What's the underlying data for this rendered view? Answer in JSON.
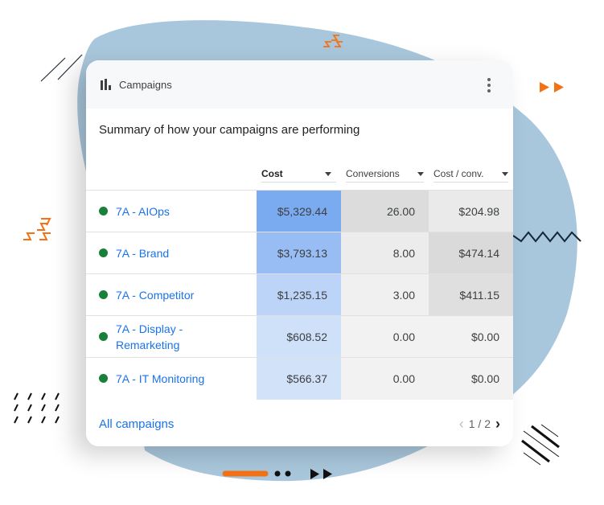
{
  "widget": {
    "title": "Campaigns",
    "subtitle": "Summary of how your campaigns are performing",
    "icon": "bar-chart-icon",
    "menu_icon": "more-vert-icon"
  },
  "table": {
    "columns": [
      {
        "label": "Cost",
        "sorted": true
      },
      {
        "label": "Conversions",
        "sorted": false
      },
      {
        "label": "Cost / conv.",
        "sorted": false
      }
    ],
    "rows": [
      {
        "name": "7A - AIOps",
        "status": "enabled",
        "cost": "$5,329.44",
        "conversions": "26.00",
        "cost_per_conv": "$204.98"
      },
      {
        "name": "7A - Brand",
        "status": "enabled",
        "cost": "$3,793.13",
        "conversions": "8.00",
        "cost_per_conv": "$474.14"
      },
      {
        "name": "7A - Competitor",
        "status": "enabled",
        "cost": "$1,235.15",
        "conversions": "3.00",
        "cost_per_conv": "$411.15"
      },
      {
        "name": "7A - Display - Remarketing",
        "status": "enabled",
        "cost": "$608.52",
        "conversions": "0.00",
        "cost_per_conv": "$0.00"
      },
      {
        "name": "7A - IT Monitoring",
        "status": "enabled",
        "cost": "$566.37",
        "conversions": "0.00",
        "cost_per_conv": "$0.00"
      }
    ]
  },
  "footer": {
    "link": "All campaigns",
    "page": "1 / 2"
  },
  "colors": {
    "link": "#1a73e8",
    "status_dot": "#188038",
    "blob": "#a9c7dc",
    "accent_orange": "#f47216"
  }
}
